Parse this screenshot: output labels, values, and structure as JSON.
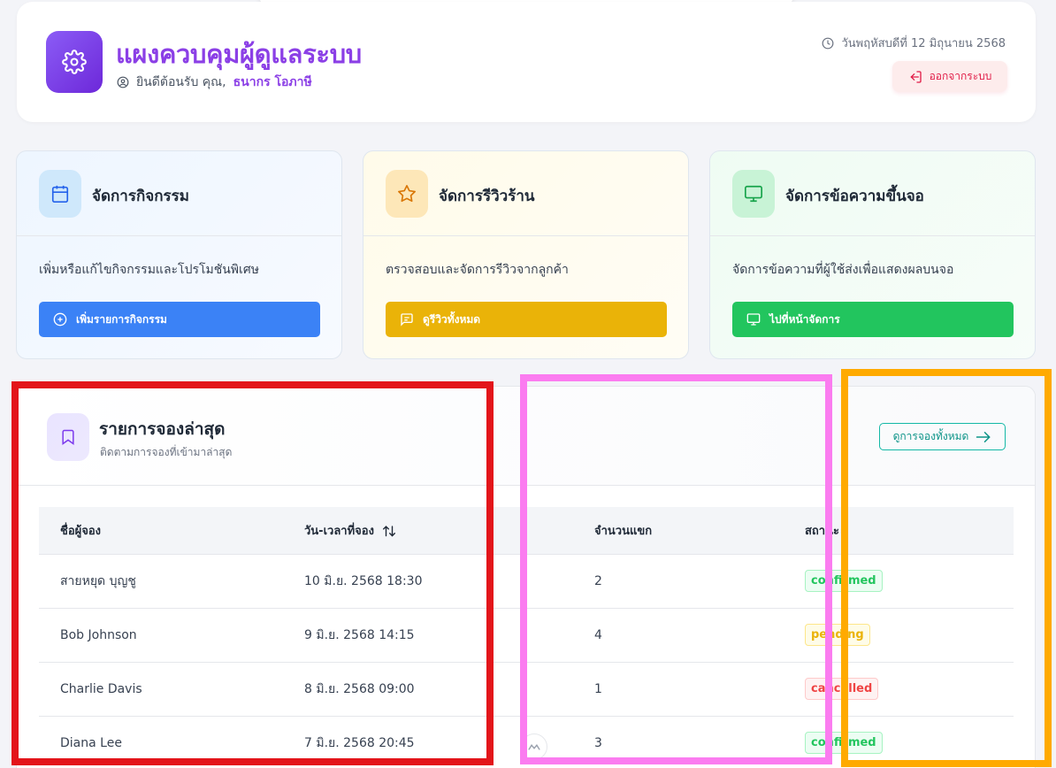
{
  "header": {
    "title": "แผงควบคุมผู้ดูแลระบบ",
    "welcome_prefix": "ยินดีต้อนรับ คุณ,",
    "user_name": "ธนากร โอภาษี",
    "date": "วันพฤหัสบดีที่ 12 มิถุนายน 2568",
    "logout_label": "ออกจากระบบ"
  },
  "cards": [
    {
      "title": "จัดการกิจกรรม",
      "desc": "เพิ่มหรือแก้ไขกิจกรรมและโปรโมชันพิเศษ",
      "button": "เพิ่มรายการกิจกรรม",
      "icon": "calendar-icon",
      "color": "#3b82f6"
    },
    {
      "title": "จัดการรีวิวร้าน",
      "desc": "ตรวจสอบและจัดการรีวิวจากลูกค้า",
      "button": "ดูรีวิวทั้งหมด",
      "icon": "star-icon",
      "color": "#eab308"
    },
    {
      "title": "จัดการข้อความขึ้นจอ",
      "desc": "จัดการข้อความที่ผู้ใช้ส่งเพื่อแสดงผลบนจอ",
      "button": "ไปที่หน้าจัดการ",
      "icon": "monitor-icon",
      "color": "#22c55e"
    }
  ],
  "bookings": {
    "title": "รายการจองล่าสุด",
    "subtitle": "ติดตามการจองที่เข้ามาล่าสุด",
    "view_all": "ดูการจองทั้งหมด",
    "columns": [
      "ชื่อผู้จอง",
      "วัน-เวลาที่จอง",
      "จำนวนแขก",
      "สถานะ"
    ],
    "rows": [
      {
        "name": "สายหยุด บุญชู",
        "datetime": "10 มิ.ย. 2568 18:30",
        "guests": "2",
        "status": "confirmed"
      },
      {
        "name": "Bob Johnson",
        "datetime": "9 มิ.ย. 2568 14:15",
        "guests": "4",
        "status": "pending"
      },
      {
        "name": "Charlie Davis",
        "datetime": "8 มิ.ย. 2568 09:00",
        "guests": "1",
        "status": "cancelled"
      },
      {
        "name": "Diana Lee",
        "datetime": "7 มิ.ย. 2568 20:45",
        "guests": "3",
        "status": "confirmed"
      }
    ]
  },
  "overlay_colors": {
    "red": "#e3151a",
    "pink": "#fb7cf0",
    "orange": "#ffaa00"
  }
}
